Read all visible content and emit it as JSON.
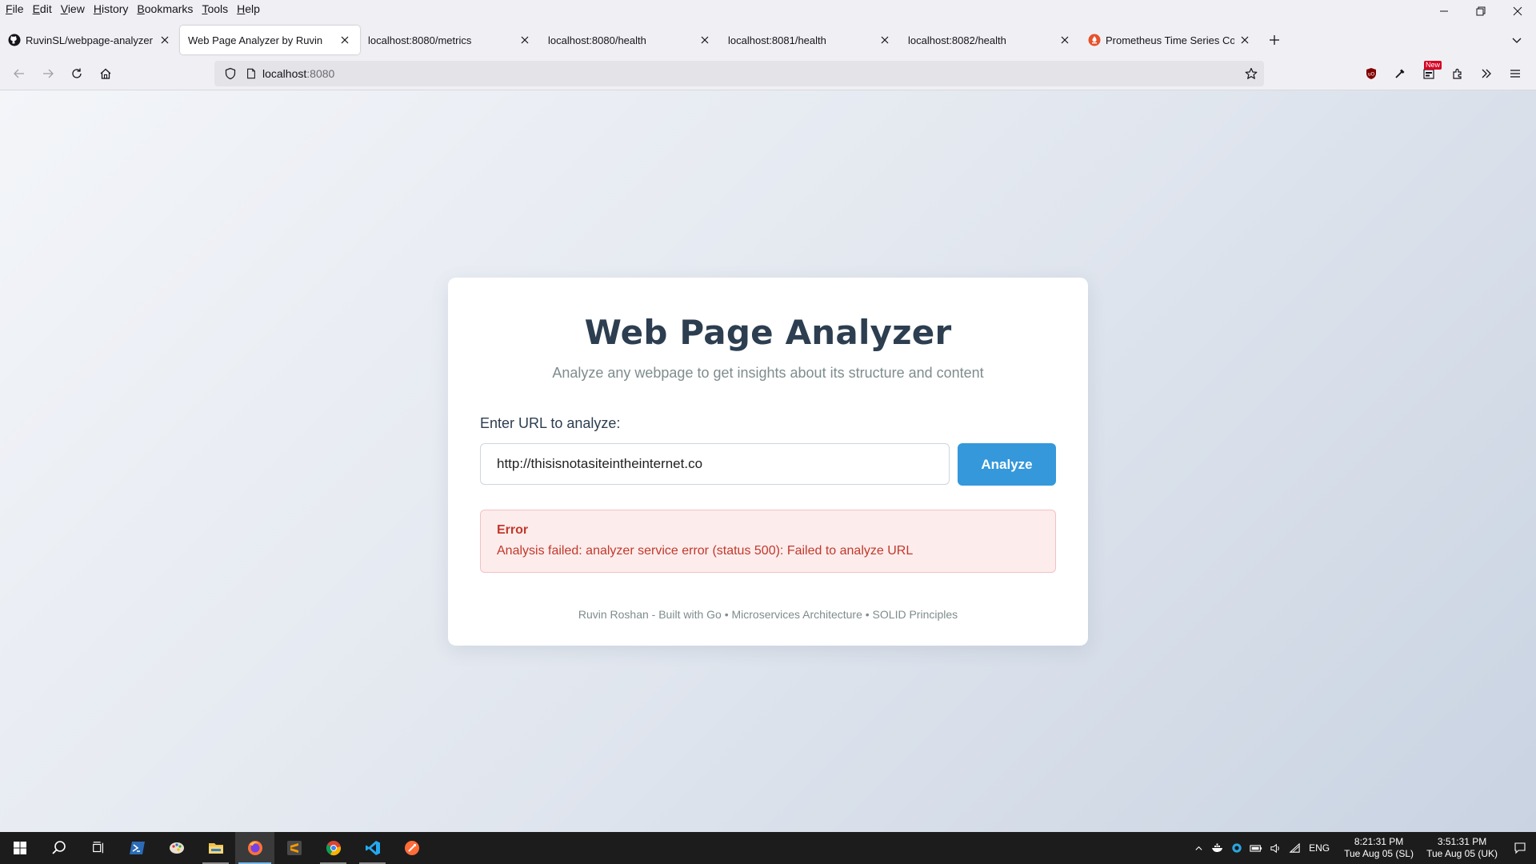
{
  "menubar": {
    "items": [
      "File",
      "Edit",
      "View",
      "History",
      "Bookmarks",
      "Tools",
      "Help"
    ]
  },
  "tabs": [
    {
      "title": "RuvinSL/webpage-analyzer",
      "icon": "github-icon",
      "active": false
    },
    {
      "title": "Web Page Analyzer by Ruvin",
      "icon": "none",
      "active": true
    },
    {
      "title": "localhost:8080/metrics",
      "icon": "none",
      "active": false
    },
    {
      "title": "localhost:8080/health",
      "icon": "none",
      "active": false
    },
    {
      "title": "localhost:8081/health",
      "icon": "none",
      "active": false
    },
    {
      "title": "localhost:8082/health",
      "icon": "none",
      "active": false
    },
    {
      "title": "Prometheus Time Series Collecti",
      "icon": "prometheus-icon",
      "active": false
    }
  ],
  "urlbar": {
    "host": "localhost",
    "port": ":8080"
  },
  "toolbar": {
    "new_badge": "New"
  },
  "page": {
    "title": "Web Page Analyzer",
    "subtitle": "Analyze any webpage to get insights about its structure and content",
    "url_label": "Enter URL to analyze:",
    "url_value": "http://thisisnotasiteintheinternet.co",
    "analyze_button": "Analyze",
    "error_title": "Error",
    "error_message": "Analysis failed: analyzer service error (status 500): Failed to analyze URL",
    "footer": "Ruvin Roshan - Built with Go • Microservices Architecture • SOLID Principles"
  },
  "taskbar": {
    "language": "ENG",
    "clock_local": {
      "time": "8:21:31 PM",
      "date": "Tue Aug 05 (SL)"
    },
    "clock_uk": {
      "time": "3:51:31 PM",
      "date": "Tue Aug 05 (UK)"
    }
  },
  "colors": {
    "accent": "#3498db",
    "title": "#2c3e50",
    "error_text": "#c0392b",
    "error_bg": "#fdecec"
  }
}
